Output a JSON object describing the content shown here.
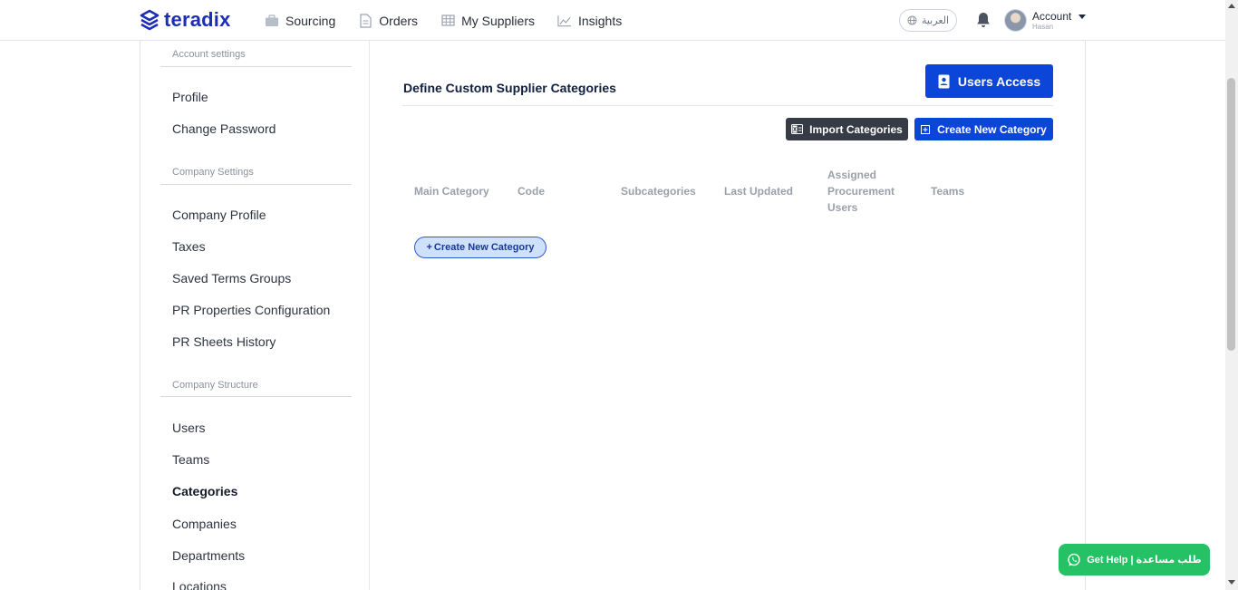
{
  "brand": {
    "name": "teradix",
    "color": "#1c2db8"
  },
  "nav": {
    "items": [
      {
        "label": "Sourcing",
        "icon": "briefcase-icon"
      },
      {
        "label": "Orders",
        "icon": "document-icon"
      },
      {
        "label": "My Suppliers",
        "icon": "table-grid-icon"
      },
      {
        "label": "Insights",
        "icon": "chart-line-icon"
      }
    ],
    "language": "العربية",
    "account": {
      "title": "Account",
      "user": "Hasan"
    }
  },
  "sidebar": {
    "sections": [
      {
        "title": "Account settings",
        "items": [
          "Profile",
          "Change Password"
        ]
      },
      {
        "title": "Company Settings",
        "items": [
          "Company Profile",
          "Taxes",
          "Saved Terms Groups",
          "PR Properties Configuration",
          "PR Sheets History"
        ]
      },
      {
        "title": "Company Structure",
        "items": [
          "Users",
          "Teams",
          "Categories",
          "Companies",
          "Departments",
          "Locations"
        ]
      }
    ],
    "active": "Categories"
  },
  "main": {
    "title": "Define Custom Supplier Categories",
    "users_access_label": "Users Access",
    "import_label": "Import Categories",
    "create_label": "Create New Category",
    "columns": [
      "Main Category",
      "Code",
      "Subcategories",
      "Last Updated",
      "Assigned\nProcurement\nUsers",
      "Teams"
    ],
    "inline_create_label": "Create New Category"
  },
  "help": {
    "label": "Get Help | طلب مساعدة"
  },
  "colors": {
    "primary": "#0b46d8",
    "dark_button": "#363b45",
    "help_green": "#25c165"
  }
}
